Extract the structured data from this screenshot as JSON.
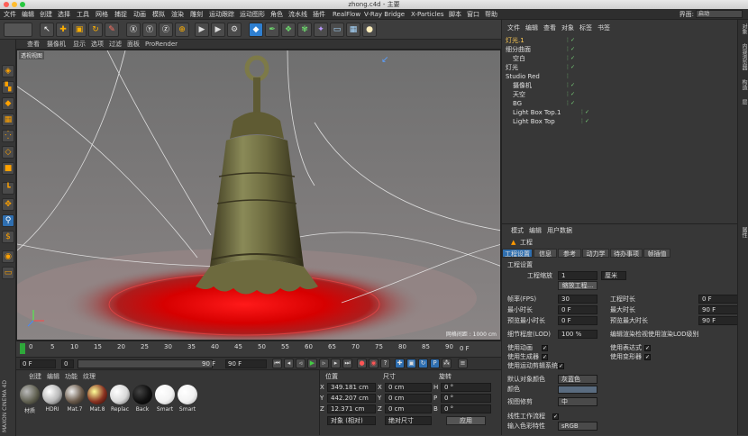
{
  "window": {
    "title": "zhong.c4d - 主要"
  },
  "menubar": {
    "items": [
      "文件",
      "编辑",
      "创建",
      "选择",
      "工具",
      "网格",
      "捕捉",
      "动画",
      "模拟",
      "渲染",
      "雕刻",
      "运动跟踪",
      "运动图形",
      "角色",
      "流水线",
      "插件",
      "RealFlow",
      "V-Ray Bridge",
      "X-Particles",
      "脚本",
      "窗口",
      "帮助"
    ],
    "layout_label": "界面:",
    "layout_value": "启动"
  },
  "viewport": {
    "menu": [
      "查看",
      "摄像机",
      "显示",
      "选项",
      "过滤",
      "面板",
      "ProRender"
    ],
    "camera_label": "透视视图",
    "grid_spacing": "网格间距 : 1000 cm"
  },
  "timeline": {
    "ticks": [
      "0",
      "5",
      "10",
      "15",
      "20",
      "25",
      "30",
      "35",
      "40",
      "45",
      "50",
      "55",
      "60",
      "65",
      "70",
      "75",
      "80",
      "85",
      "90"
    ],
    "current_frame": "0 F"
  },
  "transport": {
    "start": "0 F",
    "current": "0 F",
    "end": "90 F",
    "end2": "90 F"
  },
  "materials": {
    "menu": [
      "创建",
      "编辑",
      "功能",
      "纹理"
    ],
    "items": [
      {
        "label": "材质",
        "color": "#5a5a4a"
      },
      {
        "label": "HDRI",
        "color": "#b8b8b8"
      },
      {
        "label": "Mat.7",
        "color": "#6a5a4a"
      },
      {
        "label": "Mat.8",
        "color": "#8a3322"
      },
      {
        "label": "Replac",
        "color": "#d8d8d8"
      },
      {
        "label": "Back",
        "color": "#101010"
      },
      {
        "label": "Smart",
        "color": "#f2f2f2"
      },
      {
        "label": "Smart",
        "color": "#f2f2f2"
      }
    ]
  },
  "coords": {
    "headers": [
      "位置",
      "尺寸",
      "旋转"
    ],
    "rows": [
      {
        "axis": "X",
        "pos": "349.181 cm",
        "size": "0 cm",
        "rot_axis": "H",
        "rot": "0 °"
      },
      {
        "axis": "Y",
        "pos": "442.207 cm",
        "size": "0 cm",
        "rot_axis": "P",
        "rot": "0 °"
      },
      {
        "axis": "Z",
        "pos": "12.371 cm",
        "size": "0 cm",
        "rot_axis": "B",
        "rot": "0 °"
      }
    ],
    "mode1": "对象 (相对)",
    "mode2": "绝对尺寸",
    "apply": "应用"
  },
  "objects": {
    "menu": [
      "文件",
      "编辑",
      "查看",
      "对象",
      "标签",
      "书签"
    ],
    "rows": [
      {
        "name": "灯光.1",
        "indent": 0,
        "color": "#ffcc55"
      },
      {
        "name": "细分曲面",
        "indent": 0,
        "color": "#e0e0e0"
      },
      {
        "name": "空白",
        "indent": 1,
        "color": "#e0e0e0"
      },
      {
        "name": "灯光",
        "indent": 0,
        "color": "#e0e0e0"
      },
      {
        "name": "Studio Red",
        "indent": 0,
        "color": "#e0e0e0"
      },
      {
        "name": "摄像机",
        "indent": 1,
        "color": "#e0e0e0"
      },
      {
        "name": "天空",
        "indent": 1,
        "color": "#e0e0e0"
      },
      {
        "name": "BG",
        "indent": 1,
        "color": "#e0e0e0"
      },
      {
        "name": "Light Box Top.1",
        "indent": 1,
        "color": "#e0e0e0"
      },
      {
        "name": "Light Box Top",
        "indent": 1,
        "color": "#e0e0e0"
      }
    ]
  },
  "attributes": {
    "menu": [
      "模式",
      "编辑",
      "用户数据"
    ],
    "object_title": "工程",
    "tabs": [
      "工程设置",
      "信息",
      "参考",
      "动力学",
      "待办事项",
      "帧插值"
    ],
    "section": "工程设置",
    "scale_label": "工程缩放",
    "scale_value": "1",
    "scale_unit": "厘米",
    "scale_button": "缩放工程...",
    "fps_label": "帧率(FPS)",
    "fps": "30",
    "duration_label": "工程时长",
    "duration": "0 F",
    "min_label": "最小时长",
    "min": "0 F",
    "max_label": "最大时长",
    "max": "90 F",
    "pmin_label": "预览最小时长",
    "pmin": "0 F",
    "pmax_label": "预览最大时长",
    "pmax": "90 F",
    "lod_label": "细节程度(LOD)",
    "lod": "100 %",
    "lod_render_label": "编辑渲染检视使用渲染LOD级别",
    "anim_label": "使用动画",
    "expr_label": "使用表达式",
    "gen_label": "使用生成器",
    "deform_label": "使用变形器",
    "motion_label": "使用运动剪辑系统",
    "default_color_label": "默认对象颜色",
    "default_color": "灰蓝色",
    "color_label": "颜色",
    "clip_label": "视图修剪",
    "clip": "中",
    "linear_label": "线性工作流程",
    "input_color_label": "输入色彩特性",
    "input_color": "sRGB"
  },
  "right_tabs": [
    "对象",
    "内容浏览器",
    "构造",
    "层",
    "属性"
  ],
  "watermark": "MAXON CINEMA 4D"
}
